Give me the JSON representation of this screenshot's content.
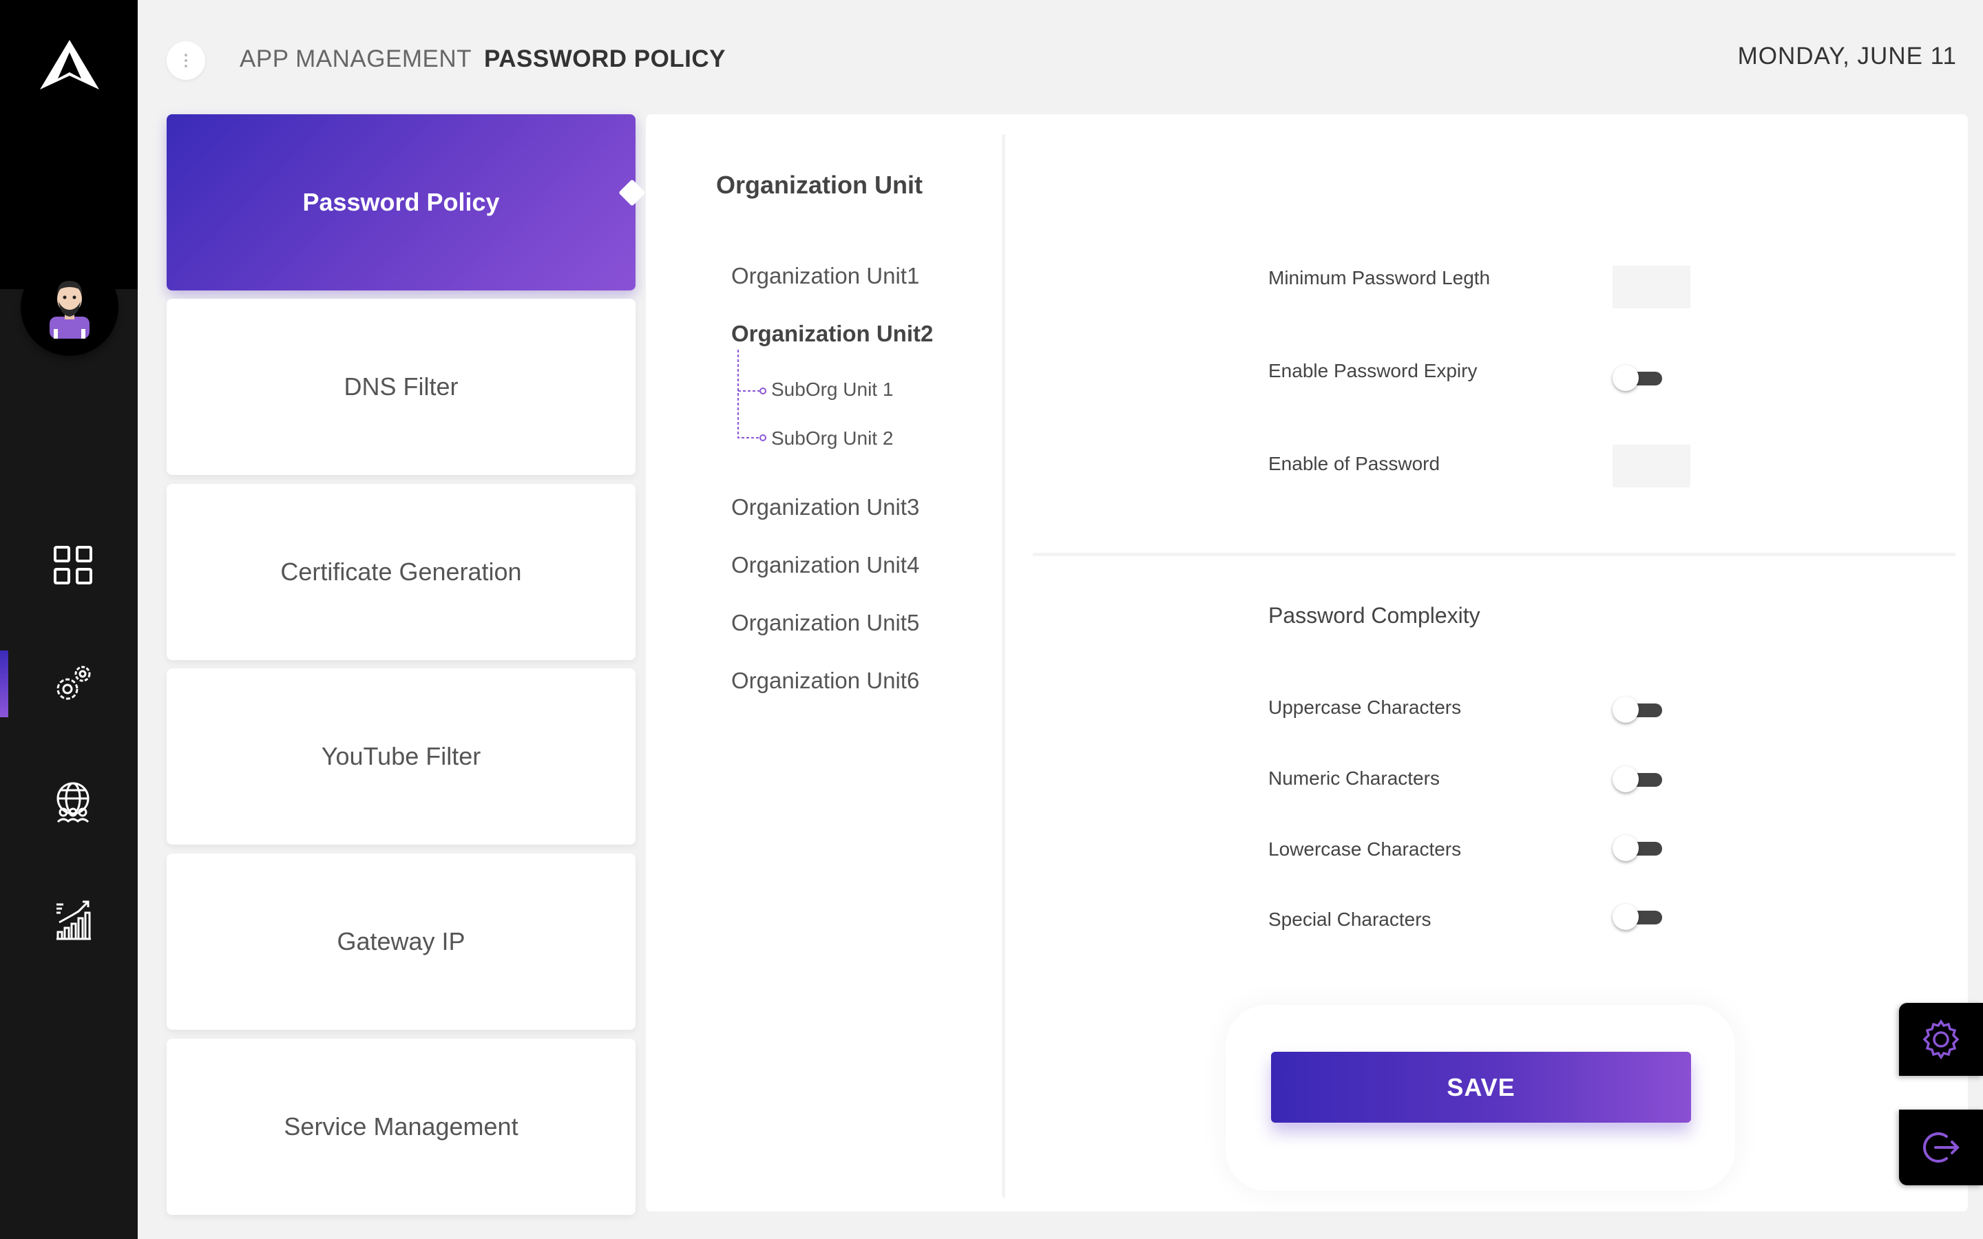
{
  "header": {
    "section": "APP MANAGEMENT",
    "page": "PASSWORD POLICY",
    "date": "MONDAY, JUNE 11"
  },
  "sidebar": {
    "icons": [
      "logo-icon",
      "user-avatar",
      "dashboard-grid-icon",
      "settings-gears-icon",
      "global-users-icon",
      "analytics-chart-icon"
    ],
    "active_item": "settings-gears-icon"
  },
  "cards": [
    {
      "label": "Password Policy",
      "active": true
    },
    {
      "label": "DNS Filter",
      "active": false
    },
    {
      "label": "Certificate Generation",
      "active": false
    },
    {
      "label": "YouTube Filter",
      "active": false
    },
    {
      "label": "Gateway IP",
      "active": false
    },
    {
      "label": "Service Management",
      "active": false
    }
  ],
  "org_units": {
    "title": "Organization Unit",
    "items": [
      {
        "label": "Organization Unit1"
      },
      {
        "label": "Organization Unit2",
        "selected": true
      },
      {
        "label": "Organization Unit3"
      },
      {
        "label": "Organization Unit4"
      },
      {
        "label": "Organization Unit5"
      },
      {
        "label": "Organization Unit6"
      }
    ],
    "sub_items": [
      {
        "label": "SubOrg Unit 1"
      },
      {
        "label": "SubOrg Unit 2"
      }
    ]
  },
  "settings": {
    "min_length_label": "Minimum Password Legth",
    "min_length_value": "",
    "expiry_label": "Enable Password Expiry",
    "expiry_on": false,
    "enable_label": "Enable of Password",
    "enable_value": ""
  },
  "complexity": {
    "title": "Password Complexity",
    "items": [
      {
        "label": "Uppercase Characters",
        "on": false
      },
      {
        "label": "Numeric Characters",
        "on": false
      },
      {
        "label": "Lowercase Characters",
        "on": false
      },
      {
        "label": "Special Characters",
        "on": false
      }
    ]
  },
  "save_label": "SAVE",
  "colors": {
    "accent_start": "#3a28b5",
    "accent_end": "#8a4fd3",
    "sidebar": "#171717",
    "toggle_track": "#444444"
  }
}
